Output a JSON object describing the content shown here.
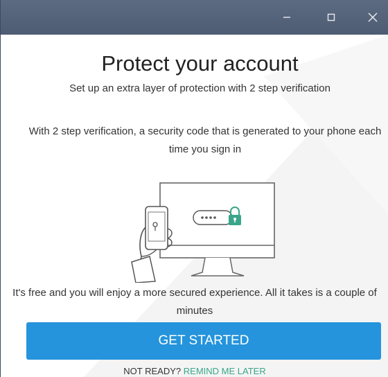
{
  "window": {
    "controls": {
      "minimize_icon": "minimize-icon",
      "maximize_icon": "maximize-icon",
      "close_icon": "close-icon"
    },
    "titlebar_color": "#56647b"
  },
  "content": {
    "title": "Protect your account",
    "subtitle": "Set up an extra layer of protection with 2 step verification",
    "description": "With 2 step verification, a security code that is generated to your phone each time you sign in",
    "footer": "It's free and you will enjoy a more secured experience. All it takes is a couple of minutes"
  },
  "actions": {
    "get_started_label": "GET STARTED",
    "not_ready_label": "NOT READY?",
    "remind_later_label": "REMIND ME LATER"
  },
  "colors": {
    "primary": "#2594dc",
    "accent": "#3aa58a"
  }
}
